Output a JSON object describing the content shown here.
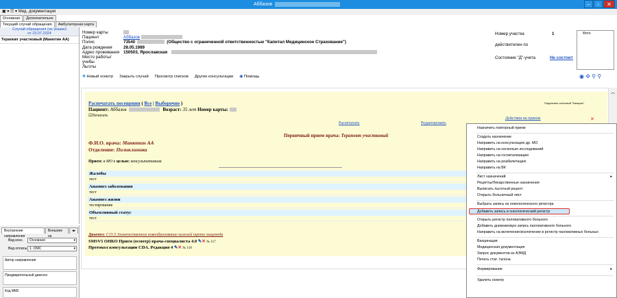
{
  "window": {
    "title": "Аббазов"
  },
  "menu": {
    "label": "Мед. документация"
  },
  "tabs": [
    "Основная",
    "Дополнительно"
  ],
  "subtabs": [
    "Текущий случай обращения",
    "Амбулаторная карта"
  ],
  "left": {
    "case_line1": "Случай обращения (не указан)",
    "case_line2": "от 23.07.2024",
    "tree_item": "Терапевт участковый (Манютин АА)",
    "tabs": [
      "Внутренние направления",
      "Внешние на"
    ],
    "kind_label": "Вид конс.",
    "kind_value": "Основная",
    "pay_label": "Вид оплаты",
    "pay_value": "1. ОМС",
    "author_label": "Автор направления",
    "prediag_label": "Предварительный диагноз",
    "mkb_label": "Код МКБ"
  },
  "patient": {
    "card_label": "Номер карты",
    "patient_label": "Пациент",
    "patient_value": "Аббазов",
    "policy_label": "Полис",
    "policy_value": "73540",
    "insurer": "(Общество с ограниченной ответственностью \"Капитал Медицинское Страхование\")",
    "birth_label": "Дата рождения",
    "birth_value": "28.05.1989",
    "address_label": "Адрес проживания",
    "address_value": "150503, Ярославская",
    "work_label": "Место работы/учебы",
    "benefits_label": "Льготы"
  },
  "right": {
    "district_label": "Номер участка",
    "district_value": "1",
    "valid_label": "действителен по",
    "d_label": "Состояние \"Д\"-учета",
    "d_value": "Не состоит",
    "photo_label": "Фото"
  },
  "toolbar": [
    "Новый осмотр",
    "Закрыть случай",
    "Просмотр списков",
    "Другие консультации",
    "Помощь"
  ],
  "doc": {
    "print_visits": "Распечатать посещения",
    "all": "Все",
    "selected": "Выборочно",
    "patient_label": "Пациент:",
    "patient_name": "Аббазов",
    "age_label": "Возраст:",
    "age_value": "35 лет",
    "card_label": "Номер карты:",
    "print_check": "☑Печатать",
    "signed": "Подписано системой \"Кипарис\"",
    "act_print": "Распечатать",
    "act_edit": "Редактировать",
    "act_actions": "Действия на приеме",
    "heading_prefix": "Первичный прием врача:",
    "heading_spec": "Терапевт участковый",
    "doctor_label": "Ф.И.О. врача:",
    "doctor_value": "Манютин АА",
    "dept_label": "Отделение:",
    "dept_value": "Поликлиника",
    "reception_a": "Прием:",
    "reception_b": "в МО",
    "reception_c": "с целью:",
    "reception_d": "консультативная",
    "sections": [
      {
        "h": "Жалобы",
        "v": "тест"
      },
      {
        "h": "Анамнез заболевания",
        "v": "тест"
      },
      {
        "h": "Анамнез жизни",
        "v": "тестирование"
      },
      {
        "h": "Объективный статус",
        "v": "тест"
      }
    ],
    "diag_label": "Диагноз:",
    "diag_value": "C15.5 Злокачественное новообразование нижней трети пищевода",
    "smsv": "SMSV5 ОНКО Прием (осмотр) врача-специалиста 4.0",
    "smsv_no": "№ 117",
    "cda": "Протокол консультации CDA. Редакция 4",
    "cda_no": "№ 118"
  },
  "menuitems": [
    "Назначить повторный прием",
    "Создать назначение",
    "Направить на консультацию др. МО",
    "Направить на несколько исследований",
    "Направить на госпитализацию",
    "Направить на реабилитацию",
    "Направить на ВК",
    "Лист назначений",
    "Рецепты/Лекарственные назначения",
    "Выписать льготный рецепт",
    "Открыть больничный лист",
    "Выбрать запись из онкологического регистра",
    "Добавить запись в онкологический регистр",
    "Открыть регистр паллиативного больного",
    "Добавить дневниковую запись паллиативного больного",
    "Направить на включение/исключение в регистр паллиативных больных",
    "Вакцинации",
    "Медицинская документация",
    "Запрос документов из АЭМД",
    "Печать стат. талона",
    "Формирование",
    "Удалить осмотр"
  ]
}
